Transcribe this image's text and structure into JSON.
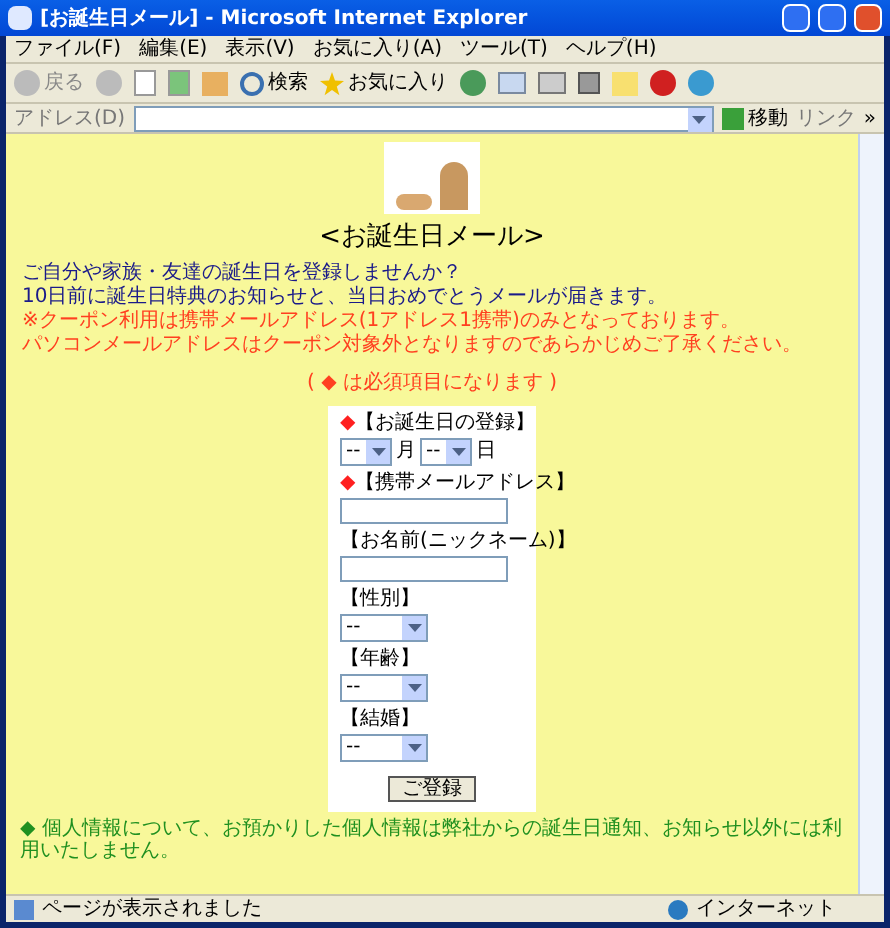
{
  "window": {
    "title": "[お誕生日メール] - Microsoft Internet Explorer"
  },
  "menu": [
    "ファイル(F)",
    "編集(E)",
    "表示(V)",
    "お気に入り(A)",
    "ツール(T)",
    "ヘルプ(H)"
  ],
  "toolbar": {
    "back": "戻る",
    "search": "検索",
    "favorites": "お気に入り"
  },
  "address_bar": {
    "label": "アドレス(D)",
    "go": "移動",
    "links": "リンク",
    "more": "»"
  },
  "page": {
    "heading": "<お誕生日メール>",
    "intro": [
      "ご自分や家族・友達の誕生日を登録しませんか？",
      "10日前に誕生日特典のお知らせと、当日おめでとうメールが届きます。"
    ],
    "notes": [
      "※クーポン利用は携帯メールアドレス(1アドレス1携帯)のみとなっております。",
      "パソコンメールアドレスはクーポン対象外となりますのであらかじめご了承ください。"
    ],
    "required_note": "( ◆ は必須項目になります )",
    "required_mark": "◆",
    "fields": [
      {
        "kind": "date",
        "label": "【お誕生日の登録】",
        "required": true,
        "month": "--",
        "month_unit": "月",
        "day": "--",
        "day_unit": "日"
      },
      {
        "kind": "text",
        "label": "【携帯メールアドレス】",
        "required": true
      },
      {
        "kind": "text",
        "label": "【お名前(ニックネーム)】",
        "required": false
      },
      {
        "kind": "select",
        "label": "【性別】",
        "required": false,
        "value": "--"
      },
      {
        "kind": "select",
        "label": "【年齢】",
        "required": false,
        "value": "--"
      },
      {
        "kind": "select",
        "label": "【結婚】",
        "required": false,
        "value": "--"
      }
    ],
    "submit": "ご登録",
    "footer": "◆ 個人情報について、お預かりした個人情報は弊社からの誕生日通知、お知らせ以外には利用いたしません。"
  },
  "status_bar": {
    "text": "ページが表示されました",
    "zone": "インターネット"
  }
}
